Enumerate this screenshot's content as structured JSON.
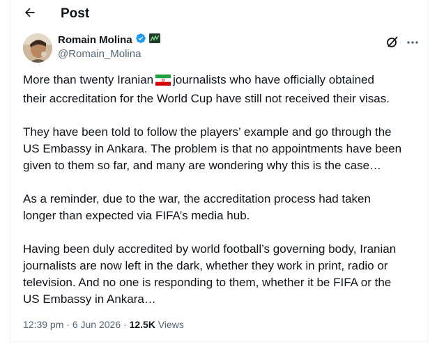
{
  "header": {
    "back_icon": "arrow-left-icon",
    "title": "Post"
  },
  "author": {
    "display_name": "Romain Molina",
    "handle": "@Romain_Molina",
    "verified_icon": "verified-badge-icon",
    "affiliate_badge_icon": "affiliate-badge-icon",
    "verified_color": "#1d9bf0"
  },
  "actions": {
    "grok_icon": "grok-icon",
    "more_icon": "more-dots-icon"
  },
  "tweet": {
    "p1_before_flag": "More than twenty Iranian",
    "flag_icon": "iran-flag-icon",
    "p1_line1_after_flag": "journalists who have officially obtained",
    "p1_line2": "their accreditation for the World Cup have still not received their visas.",
    "p2_line1": "They have been told to follow the players’ example and go through the",
    "p2_line2": "US Embassy in Ankara. The problem is that no appointments have been",
    "p2_line3": "given to them so far, and many are wondering why this is the case…",
    "p3_line1": "As a reminder, due to the war, the accreditation process had taken",
    "p3_line2": "longer than expected via FIFA’s media hub.",
    "p4_line1": "Having been duly accredited by world football’s governing body, Iranian",
    "p4_line2": "journalists are now left in the dark, whether they work in print, radio or",
    "p4_line3": "television. And no one is responding to them, whether it be FIFA or the",
    "p4_line4": "US Embassy in Ankara…"
  },
  "meta": {
    "time": "12:39 pm",
    "separator": "·",
    "date": "6 Jun 2026",
    "views_count": "12.5K",
    "views_label": "Views"
  }
}
